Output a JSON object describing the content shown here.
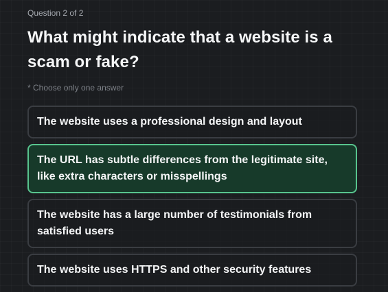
{
  "quiz": {
    "progress": "Question 2 of 2",
    "question": "What might indicate that a website is a scam or fake?",
    "instruction": "* Choose only one answer",
    "selected_index": 1,
    "options": [
      {
        "label": "The website uses a professional design and layout",
        "selected": false
      },
      {
        "label": "The URL has subtle differences from the legitimate site, like extra characters or misspellings",
        "selected": true
      },
      {
        "label": "The website has a large number of testimonials from satisfied users",
        "selected": false
      },
      {
        "label": "The website uses HTTPS and other security features",
        "selected": false
      }
    ]
  },
  "colors": {
    "background": "#1b1d20",
    "option_border": "#3a3d42",
    "selected_border": "#58c48e",
    "selected_background": "#173a2a"
  }
}
